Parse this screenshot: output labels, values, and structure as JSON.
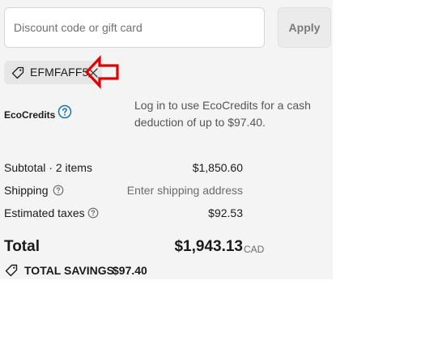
{
  "discount": {
    "placeholder": "Discount code or gift card",
    "value": "",
    "apply_label": "Apply"
  },
  "applied_code": {
    "code": "EFMFAFF5"
  },
  "ecocredits": {
    "label": "EcoCredits",
    "description": "Log in to use EcoCredits for a cash deduction of up to $97.40."
  },
  "summary": {
    "subtotal_label": "Subtotal · 2 items",
    "subtotal_value": "$1,850.60",
    "shipping_label": "Shipping",
    "shipping_value": "Enter shipping address",
    "taxes_label": "Estimated taxes",
    "taxes_value": "$92.53"
  },
  "total": {
    "label": "Total",
    "currency": "CAD",
    "value": "$1,943.13"
  },
  "savings": {
    "label": "TOTAL SAVINGS",
    "value": "$97.40"
  },
  "colors": {
    "panel_bg": "#f4f4f4",
    "help_blue": "#1773b0",
    "annotation_red": "#e00000"
  },
  "icons": {
    "tag": "tag-icon",
    "remove": "close-icon",
    "help": "question-circle-icon",
    "annotation": "left-arrow-annotation"
  }
}
